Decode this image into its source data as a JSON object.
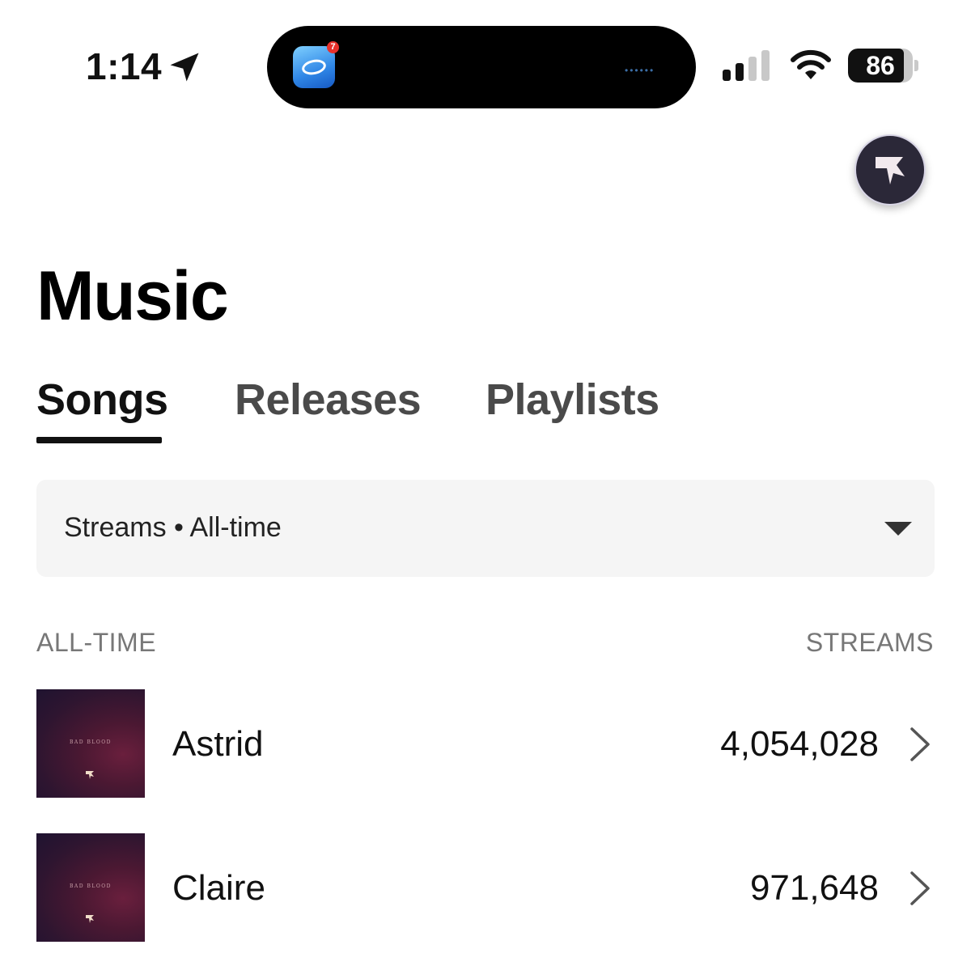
{
  "status_bar": {
    "time": "1:14",
    "battery_level": "86",
    "notification_count": "7",
    "signal_bars_active": 2,
    "signal_bars_total": 4
  },
  "page": {
    "title": "Music"
  },
  "tabs": [
    {
      "label": "Songs",
      "active": true
    },
    {
      "label": "Releases",
      "active": false
    },
    {
      "label": "Playlists",
      "active": false
    }
  ],
  "filter": {
    "label": "Streams • All-time"
  },
  "list": {
    "left_header": "ALL-TIME",
    "right_header": "STREAMS",
    "rows": [
      {
        "title": "Astrid",
        "streams": "4,054,028",
        "cover_text": "BAD BLOOD"
      },
      {
        "title": "Claire",
        "streams": "971,648",
        "cover_text": "BAD BLOOD"
      }
    ]
  },
  "colors": {
    "accent": "#111111",
    "cover": "#4a1832",
    "avatar_bg": "#2b2838"
  },
  "icons": {
    "location": "location-arrow-icon",
    "signal": "cellular-signal-icon",
    "wifi": "wifi-icon",
    "battery": "battery-icon",
    "avatar": "profile-logo-icon",
    "filter": "caret-down-icon",
    "row": "chevron-right-icon"
  }
}
